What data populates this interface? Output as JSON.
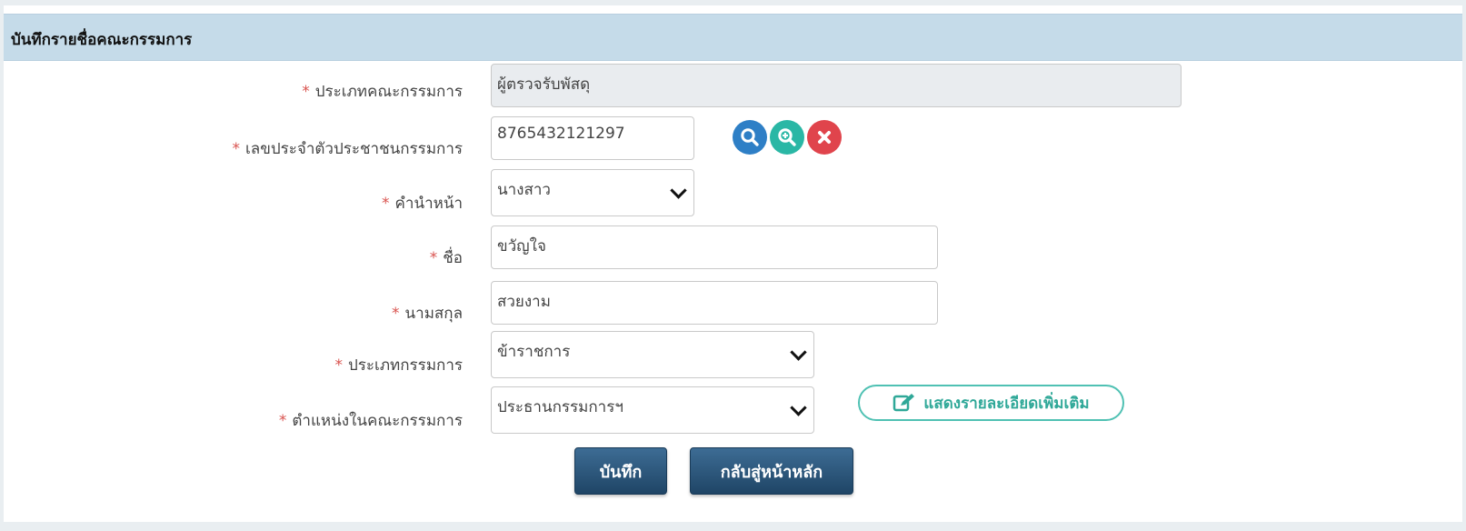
{
  "panel": {
    "title": "บันทึกรายชื่อคณะกรรมการ"
  },
  "form": {
    "required_mark": "*",
    "committee_type": {
      "label": "ประเภทคณะกรรมการ",
      "value": "ผู้ตรวจรับพัสดุ"
    },
    "citizen_id": {
      "label": "เลขประจำตัวประชาชนกรรมการ",
      "value": "8765432121297"
    },
    "prefix": {
      "label": "คำนำหน้า",
      "value": "นางสาว"
    },
    "first_name": {
      "label": "ชื่อ",
      "value": "ขวัญใจ"
    },
    "last_name": {
      "label": "นามสกุล",
      "value": "สวยงาม"
    },
    "member_type": {
      "label": "ประเภทกรรมการ",
      "value": "ข้าราชการ"
    },
    "position": {
      "label": "ตำแหน่งในคณะกรรมการ",
      "value": "ประธานกรรมการฯ"
    }
  },
  "buttons": {
    "show_details": "แสดงรายละเอียดเพิ่มเติม",
    "save": "บันทึก",
    "back_home": "กลับสู่หน้าหลัก"
  },
  "icons": {
    "search": "search-icon",
    "zoom_in": "zoom-in-icon",
    "clear": "clear-icon",
    "edit": "edit-icon"
  },
  "colors": {
    "header_bg": "#c5dbe9",
    "required": "#d9534f",
    "search_icon": "#2e7fc6",
    "zoom_icon": "#2ab7a5",
    "clear_icon": "#e0444c",
    "primary_button": "#2a5378",
    "detail_button": "#4fc1b3"
  }
}
